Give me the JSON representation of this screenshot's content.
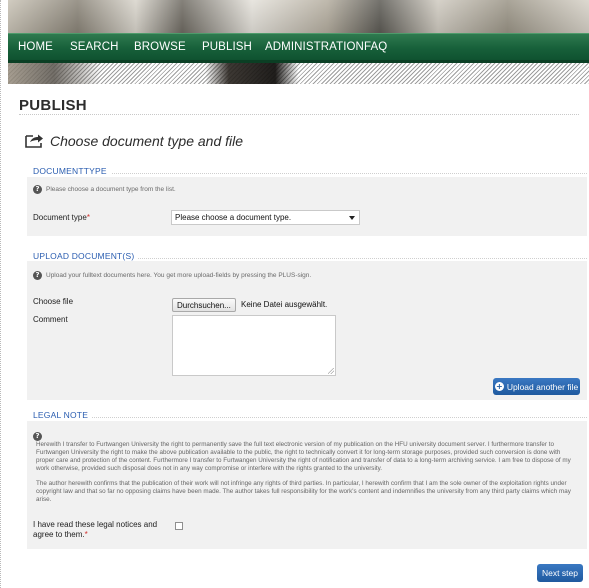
{
  "nav": {
    "items": [
      "HOME",
      "SEARCH",
      "BROWSE",
      "PUBLISH",
      "ADMINISTRATION",
      "FAQ"
    ]
  },
  "page": {
    "title": "PUBLISH",
    "heading": "Choose document type and file"
  },
  "documenttype": {
    "legend": "DOCUMENTTYPE",
    "hint": "Please choose a document type from the list.",
    "label": "Document type",
    "required_mark": "*",
    "select_value": "Please choose a document type."
  },
  "upload": {
    "legend": "UPLOAD DOCUMENT(S)",
    "hint": "Upload your fulltext documents here. You get more upload-fields by pressing the PLUS-sign.",
    "choose_file_label": "Choose file",
    "browse_button": "Durchsuchen...",
    "file_status": "Keine Datei ausgewählt.",
    "comment_label": "Comment",
    "comment_value": "",
    "add_button": "Upload another file"
  },
  "legal": {
    "legend": "LEGAL NOTE",
    "paragraph1": "Herewith I transfer to Furtwangen University the right to permanently save the full text electronic version of my publication on the HFU university document server. I furthermore transfer to Furtwangen University the right to make the above publication available to the public, the right to technically convert it for long-term storage purposes, provided such conversion is done with proper care and protection of the content. Furthermore I transfer to Furtwangen University the right of notification and transfer of data to a long-term archiving service. I am free to dispose of my work otherwise, provided such disposal does not in any way compromise or interfere with the rights granted to the university.",
    "paragraph2": "The author herewith confirms that the publication of their work will not infringe any rights of third parties. In particular, I herewith confirm that I am the sole owner of the exploitation rights under copyright law and that so far no opposing claims have been made. The author takes full responsibility for the work's content and indemnifies the university from any third party claims which may arise.",
    "agree_label": "I have read these legal notices and agree to them.",
    "required_mark": "*",
    "agree_checked": false
  },
  "actions": {
    "next": "Next step"
  },
  "colors": {
    "nav_green": "#17603a",
    "link_blue": "#2a5db0",
    "button_blue": "#2a68b1",
    "required_red": "#d0312d"
  }
}
